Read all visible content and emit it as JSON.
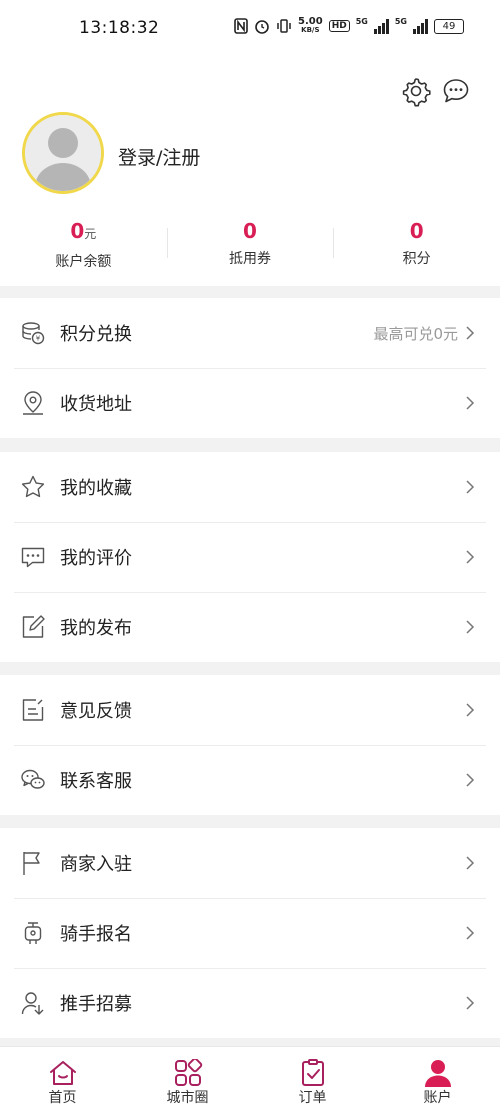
{
  "status_bar": {
    "time": "13:18:32",
    "speed_value": "5.00",
    "speed_unit": "KB/S",
    "hd": "HD",
    "network_1": "5G",
    "network_2": "5G",
    "battery": "49"
  },
  "header": {
    "login_label": "登录/注册",
    "stats": [
      {
        "value": "0",
        "unit": "元",
        "label": "账户余额"
      },
      {
        "value": "0",
        "unit": "",
        "label": "抵用券"
      },
      {
        "value": "0",
        "unit": "",
        "label": "积分"
      }
    ]
  },
  "menu": {
    "points_exchange": {
      "label": "积分兑换",
      "extra": "最高可兑0元"
    },
    "shipping_address": {
      "label": "收货地址"
    },
    "favorites": {
      "label": "我的收藏"
    },
    "reviews": {
      "label": "我的评价"
    },
    "posts": {
      "label": "我的发布"
    },
    "feedback": {
      "label": "意见反馈"
    },
    "customer_service": {
      "label": "联系客服"
    },
    "merchant_join": {
      "label": "商家入驻"
    },
    "rider_signup": {
      "label": "骑手报名"
    },
    "promoter_recruit": {
      "label": "推手招募"
    }
  },
  "tabbar": {
    "tabs": [
      {
        "label": "首页"
      },
      {
        "label": "城市圈"
      },
      {
        "label": "订单"
      },
      {
        "label": "账户"
      }
    ]
  },
  "colors": {
    "accent": "#d81e54",
    "tab_icon": "#a8205d",
    "avatar_ring": "#f0d84a"
  }
}
